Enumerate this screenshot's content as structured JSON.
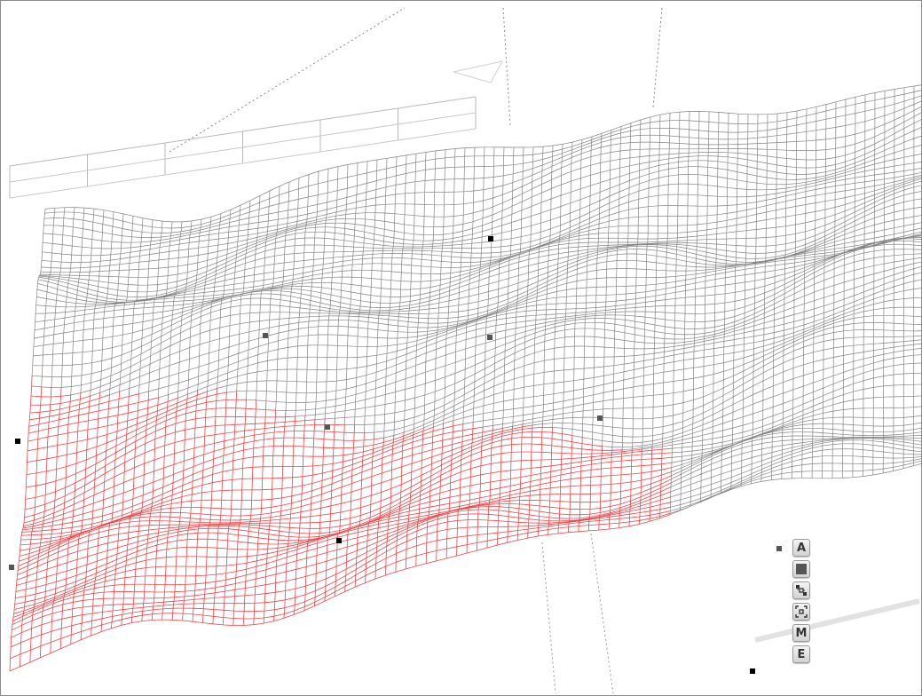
{
  "viewport": {
    "background": "#ffffff",
    "border_color": "#8c8c8c"
  },
  "meshes": [
    {
      "name": "terrain",
      "color": "#5a5a5a"
    },
    {
      "name": "selection",
      "color": "#e8262a"
    }
  ],
  "toolbar": {
    "buttons": [
      {
        "id": "axes",
        "label": "A",
        "icon": "letter-a-icon"
      },
      {
        "id": "fill",
        "label": "",
        "icon": "solid-square-icon"
      },
      {
        "id": "connect",
        "label": "",
        "icon": "connected-nodes-icon"
      },
      {
        "id": "fit",
        "label": "",
        "icon": "frame-target-icon"
      },
      {
        "id": "mesh",
        "label": "M",
        "icon": "letter-m-icon"
      },
      {
        "id": "edges",
        "label": "E",
        "icon": "letter-e-icon"
      }
    ]
  }
}
